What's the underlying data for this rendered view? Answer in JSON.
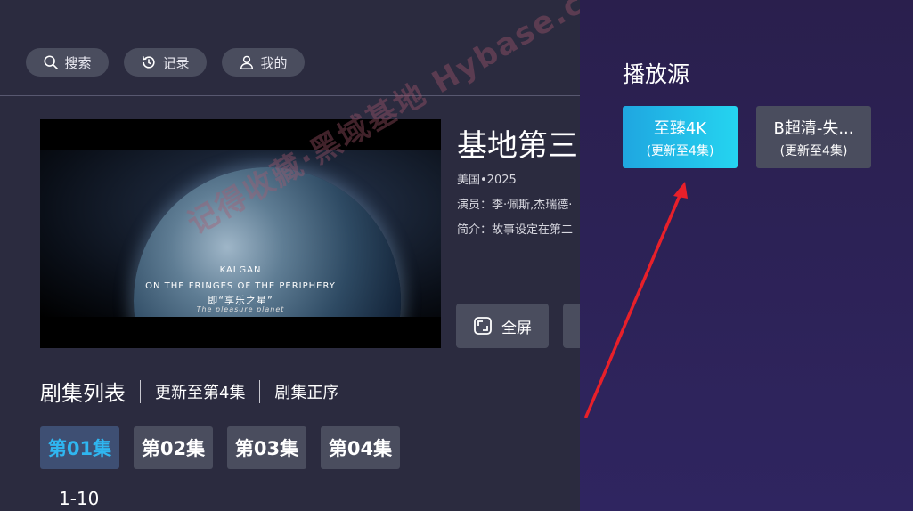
{
  "nav": {
    "search_label": "搜索",
    "history_label": "记录",
    "mine_label": "我的"
  },
  "player": {
    "subtitle_1": "KALGAN",
    "subtitle_2": "ON THE FRINGES OF THE PERIPHERY",
    "subtitle_3": "即“享乐之星”",
    "subtitle_4": "The pleasure planet",
    "watermark": "记得收藏·黑域基地 Hybase.com"
  },
  "details": {
    "title": "基地第三",
    "meta": "美国•2025",
    "cast": "演员：李·佩斯,杰瑞德·",
    "intro": "简介：故事设定在第二",
    "fullscreen_label": "全屏"
  },
  "episodes": {
    "header": "剧集列表",
    "update_status": "更新至第4集",
    "order_label": "剧集正序",
    "items": [
      "第01集",
      "第02集",
      "第03集",
      "第04集"
    ],
    "active_index": 0,
    "range": "1-10"
  },
  "source_panel": {
    "title": "播放源",
    "sources": [
      {
        "name": "至臻4K",
        "update": "(更新至4集)"
      },
      {
        "name": "B超清-失...",
        "update": "(更新至4集)"
      }
    ],
    "selected_index": 0
  },
  "colors": {
    "background": "#2b2b3f",
    "button": "#4a4d5e",
    "accent": "#2fb6f0",
    "panel": "#2a1f4d",
    "annotation_arrow": "#e8202a"
  }
}
